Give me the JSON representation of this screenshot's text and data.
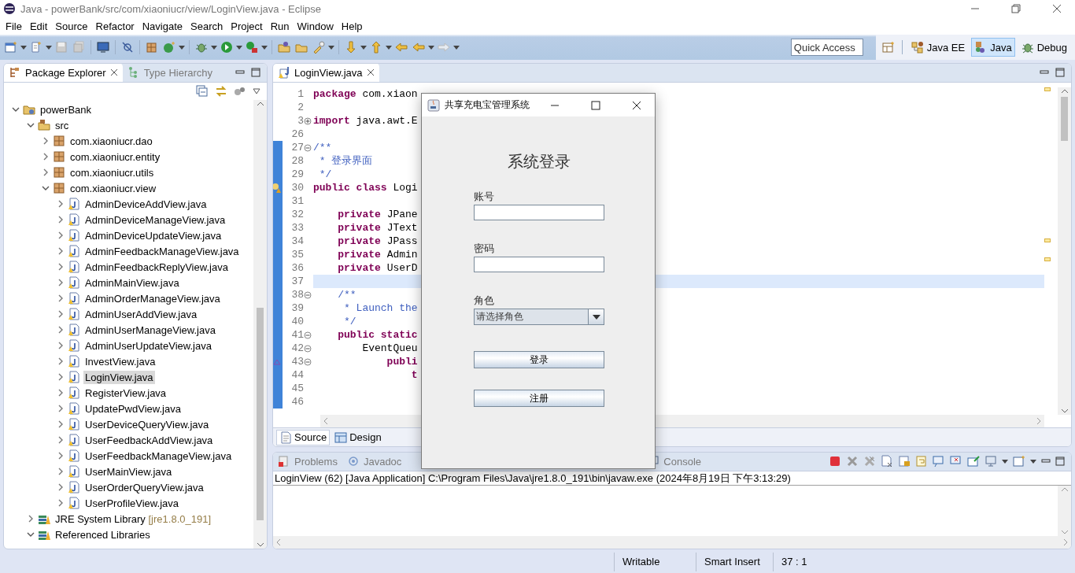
{
  "window": {
    "title": "Java - powerBank/src/com/xiaoniucr/view/LoginView.java - Eclipse"
  },
  "menu": [
    "File",
    "Edit",
    "Source",
    "Refactor",
    "Navigate",
    "Search",
    "Project",
    "Run",
    "Window",
    "Help"
  ],
  "quick_access": {
    "placeholder": "Quick Access"
  },
  "perspectives": [
    {
      "label": "Java EE",
      "selected": false,
      "kind": "javaee"
    },
    {
      "label": "Java",
      "selected": true,
      "kind": "java"
    },
    {
      "label": "Debug",
      "selected": false,
      "kind": "debug"
    }
  ],
  "explorer": {
    "tabs": [
      {
        "label": "Package Explorer",
        "selected": true,
        "kind": "explorer"
      },
      {
        "label": "Type Hierarchy",
        "selected": false,
        "kind": "hierarchy"
      }
    ],
    "tree": [
      {
        "label": "powerBank",
        "kind": "project",
        "expanded": true,
        "selected": false,
        "children": [
          {
            "label": "src",
            "kind": "source",
            "expanded": true,
            "selected": false,
            "children": [
              {
                "label": "com.xiaoniucr.dao",
                "kind": "package",
                "expanded": false,
                "selected": false
              },
              {
                "label": "com.xiaoniucr.entity",
                "kind": "package",
                "expanded": false,
                "selected": false
              },
              {
                "label": "com.xiaoniucr.utils",
                "kind": "package",
                "expanded": false,
                "selected": false
              },
              {
                "label": "com.xiaoniucr.view",
                "kind": "package",
                "expanded": true,
                "selected": false,
                "children": [
                  {
                    "label": "AdminDeviceAddView.java",
                    "kind": "file",
                    "expanded": false,
                    "selected": false
                  },
                  {
                    "label": "AdminDeviceManageView.java",
                    "kind": "file",
                    "expanded": false,
                    "selected": false
                  },
                  {
                    "label": "AdminDeviceUpdateView.java",
                    "kind": "file",
                    "expanded": false,
                    "selected": false
                  },
                  {
                    "label": "AdminFeedbackManageView.java",
                    "kind": "file",
                    "expanded": false,
                    "selected": false
                  },
                  {
                    "label": "AdminFeedbackReplyView.java",
                    "kind": "file",
                    "expanded": false,
                    "selected": false
                  },
                  {
                    "label": "AdminMainView.java",
                    "kind": "file",
                    "expanded": false,
                    "selected": false
                  },
                  {
                    "label": "AdminOrderManageView.java",
                    "kind": "file",
                    "expanded": false,
                    "selected": false
                  },
                  {
                    "label": "AdminUserAddView.java",
                    "kind": "file",
                    "expanded": false,
                    "selected": false
                  },
                  {
                    "label": "AdminUserManageView.java",
                    "kind": "file",
                    "expanded": false,
                    "selected": false
                  },
                  {
                    "label": "AdminUserUpdateView.java",
                    "kind": "file",
                    "expanded": false,
                    "selected": false
                  },
                  {
                    "label": "InvestView.java",
                    "kind": "file",
                    "expanded": false,
                    "selected": false
                  },
                  {
                    "label": "LoginView.java",
                    "kind": "file",
                    "expanded": false,
                    "selected": true
                  },
                  {
                    "label": "RegisterView.java",
                    "kind": "file",
                    "expanded": false,
                    "selected": false
                  },
                  {
                    "label": "UpdatePwdView.java",
                    "kind": "file",
                    "expanded": false,
                    "selected": false
                  },
                  {
                    "label": "UserDeviceQueryView.java",
                    "kind": "file",
                    "expanded": false,
                    "selected": false
                  },
                  {
                    "label": "UserFeedbackAddView.java",
                    "kind": "file",
                    "expanded": false,
                    "selected": false
                  },
                  {
                    "label": "UserFeedbackManageView.java",
                    "kind": "file",
                    "expanded": false,
                    "selected": false
                  },
                  {
                    "label": "UserMainView.java",
                    "kind": "file",
                    "expanded": false,
                    "selected": false
                  },
                  {
                    "label": "UserOrderQueryView.java",
                    "kind": "file",
                    "expanded": false,
                    "selected": false
                  },
                  {
                    "label": "UserProfileView.java",
                    "kind": "file",
                    "expanded": false,
                    "selected": false
                  }
                ]
              }
            ]
          },
          {
            "label": "JRE System Library",
            "suffix": "[jre1.8.0_191]",
            "kind": "library",
            "expanded": false,
            "selected": false
          },
          {
            "label": "Referenced Libraries",
            "kind": "library",
            "expanded": true,
            "selected": false
          }
        ]
      }
    ]
  },
  "editor": {
    "tabs": [
      {
        "label": "LoginView.java",
        "selected": true
      }
    ],
    "lines": [
      {
        "number": "1",
        "warning": false,
        "override": false,
        "current": false,
        "changed": false,
        "parts": [
          {
            "text": "package",
            "kind": "keyword"
          },
          {
            "text": " com.xiaon",
            "kind": "plain"
          }
        ]
      },
      {
        "number": "2",
        "warning": false,
        "override": false,
        "current": false,
        "changed": false
      },
      {
        "number": "3",
        "folded": true,
        "warning": false,
        "override": false,
        "current": false,
        "changed": false,
        "parts": [
          {
            "text": "import",
            "kind": "keyword"
          },
          {
            "text": " java.awt.E",
            "kind": "plain"
          }
        ]
      },
      {
        "number": "26",
        "warning": false,
        "override": false,
        "current": false,
        "changed": false
      },
      {
        "number": "27",
        "folded": false,
        "warning": false,
        "override": false,
        "current": false,
        "changed": true,
        "parts": [
          {
            "text": "/**",
            "kind": "comment"
          }
        ]
      },
      {
        "number": "28",
        "warning": false,
        "override": false,
        "current": false,
        "changed": true,
        "parts": [
          {
            "text": " * 登录界面",
            "kind": "comment"
          }
        ]
      },
      {
        "number": "29",
        "warning": false,
        "override": false,
        "current": false,
        "changed": true,
        "parts": [
          {
            "text": " */",
            "kind": "comment"
          }
        ]
      },
      {
        "number": "30",
        "warning": true,
        "override": false,
        "current": false,
        "changed": true,
        "parts": [
          {
            "text": "public class",
            "kind": "keyword"
          },
          {
            "text": " Logi",
            "kind": "plain"
          }
        ]
      },
      {
        "number": "31",
        "warning": false,
        "override": false,
        "current": false,
        "changed": true
      },
      {
        "number": "32",
        "warning": false,
        "override": false,
        "current": false,
        "changed": true,
        "parts": [
          {
            "text": "    private",
            "kind": "keyword"
          },
          {
            "text": " JPane",
            "kind": "plain"
          }
        ]
      },
      {
        "number": "33",
        "warning": false,
        "override": false,
        "current": false,
        "changed": true,
        "parts": [
          {
            "text": "    private",
            "kind": "keyword"
          },
          {
            "text": " JText",
            "kind": "plain"
          }
        ]
      },
      {
        "number": "34",
        "warning": false,
        "override": false,
        "current": false,
        "changed": true,
        "parts": [
          {
            "text": "    private",
            "kind": "keyword"
          },
          {
            "text": " JPass",
            "kind": "plain"
          }
        ]
      },
      {
        "number": "35",
        "warning": false,
        "override": false,
        "current": false,
        "changed": true,
        "parts": [
          {
            "text": "    private",
            "kind": "keyword"
          },
          {
            "text": " Admin",
            "kind": "plain"
          }
        ]
      },
      {
        "number": "36",
        "warning": false,
        "override": false,
        "current": false,
        "changed": true,
        "parts": [
          {
            "text": "    private",
            "kind": "keyword"
          },
          {
            "text": " UserD",
            "kind": "plain"
          }
        ]
      },
      {
        "number": "37",
        "warning": false,
        "override": false,
        "current": true,
        "changed": true
      },
      {
        "number": "38",
        "folded": false,
        "warning": false,
        "override": false,
        "current": false,
        "changed": true,
        "parts": [
          {
            "text": "    /**",
            "kind": "comment"
          }
        ]
      },
      {
        "number": "39",
        "warning": false,
        "override": false,
        "current": false,
        "changed": true,
        "parts": [
          {
            "text": "     * Launch the",
            "kind": "comment"
          }
        ]
      },
      {
        "number": "40",
        "warning": false,
        "override": false,
        "current": false,
        "changed": true,
        "parts": [
          {
            "text": "     */",
            "kind": "comment"
          }
        ]
      },
      {
        "number": "41",
        "folded": false,
        "warning": false,
        "override": false,
        "current": false,
        "changed": true,
        "parts": [
          {
            "text": "    public static",
            "kind": "keyword"
          }
        ]
      },
      {
        "number": "42",
        "folded": false,
        "warning": false,
        "override": false,
        "current": false,
        "changed": true,
        "parts": [
          {
            "text": "        EventQueu",
            "kind": "plain"
          }
        ]
      },
      {
        "number": "43",
        "folded": false,
        "warning": false,
        "override": true,
        "current": false,
        "changed": true,
        "parts": [
          {
            "text": "            publi",
            "kind": "keyword"
          }
        ]
      },
      {
        "number": "44",
        "warning": false,
        "override": false,
        "current": false,
        "changed": true,
        "parts": [
          {
            "text": "                t",
            "kind": "keyword"
          }
        ]
      },
      {
        "number": "45",
        "warning": false,
        "override": false,
        "current": false,
        "changed": true
      },
      {
        "number": "46",
        "warning": false,
        "override": false,
        "current": false,
        "changed": true
      }
    ],
    "bottom_tabs": [
      {
        "label": "Source",
        "selected": true,
        "kind": "source"
      },
      {
        "label": "Design",
        "selected": false,
        "kind": "design"
      }
    ]
  },
  "console": {
    "tabs": [
      {
        "label": "Problems",
        "selected": false,
        "kind": "problems"
      },
      {
        "label": "Javadoc",
        "selected": false,
        "kind": "javadoc"
      },
      {
        "label": "Console",
        "selected": false,
        "kind": "console"
      }
    ],
    "process": "LoginView (62) [Java Application] C:\\Program Files\\Java\\jre1.8.0_191\\bin\\javaw.exe (2024年8月19日 下午3:13:29)"
  },
  "status_bar": [
    "Writable",
    "Smart Insert",
    "37 : 1"
  ],
  "dialog": {
    "title": "共享充电宝管理系统",
    "heading": "系统登录",
    "fields": [
      {
        "label": "账号",
        "kind": "text"
      },
      {
        "label": "密码",
        "kind": "password"
      },
      {
        "label": "角色",
        "kind": "select",
        "value": "请选择角色"
      }
    ],
    "buttons": [
      "登录",
      "注册"
    ]
  }
}
